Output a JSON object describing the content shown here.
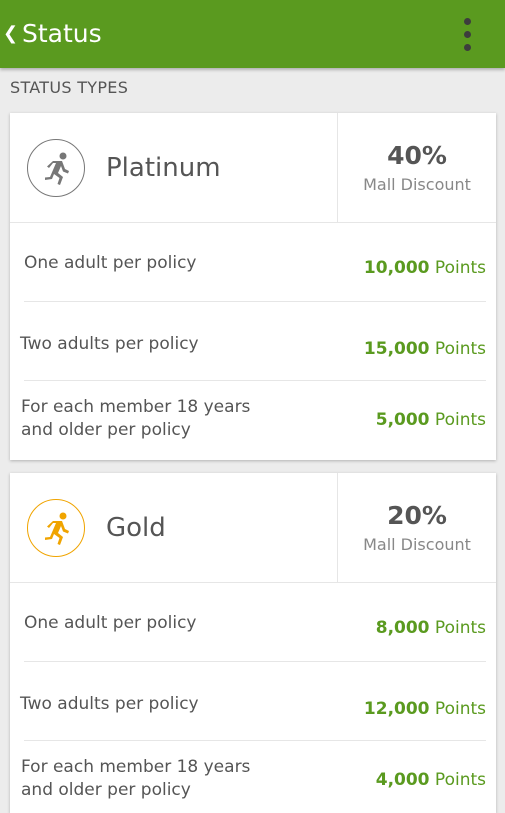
{
  "header": {
    "back_glyph": "❮",
    "title": "Status"
  },
  "section_title": "STATUS TYPES",
  "tiers": [
    {
      "name": "Platinum",
      "icon": "running-person-icon",
      "icon_color": "#777777",
      "discount_pct": "40%",
      "discount_label": "Mall Discount",
      "rows": [
        {
          "label": "One adult per policy",
          "points": "10,000",
          "unit": "Points"
        },
        {
          "label": "Two adults per policy",
          "points": "15,000",
          "unit": "Points"
        },
        {
          "label_line1": "For each member 18 years",
          "label_line2": "and older per policy",
          "points": "5,000",
          "unit": "Points"
        }
      ]
    },
    {
      "name": "Gold",
      "icon": "running-person-icon",
      "icon_color": "#f0a400",
      "discount_pct": "20%",
      "discount_label": "Mall Discount",
      "rows": [
        {
          "label": "One adult per policy",
          "points": "8,000",
          "unit": "Points"
        },
        {
          "label": "Two adults per policy",
          "points": "12,000",
          "unit": "Points"
        },
        {
          "label_line1": "For each member 18 years",
          "label_line2": "and older per policy",
          "points": "4,000",
          "unit": "Points"
        }
      ]
    }
  ],
  "colors": {
    "appbar": "#5a9a1f",
    "points": "#5a9a1f"
  }
}
